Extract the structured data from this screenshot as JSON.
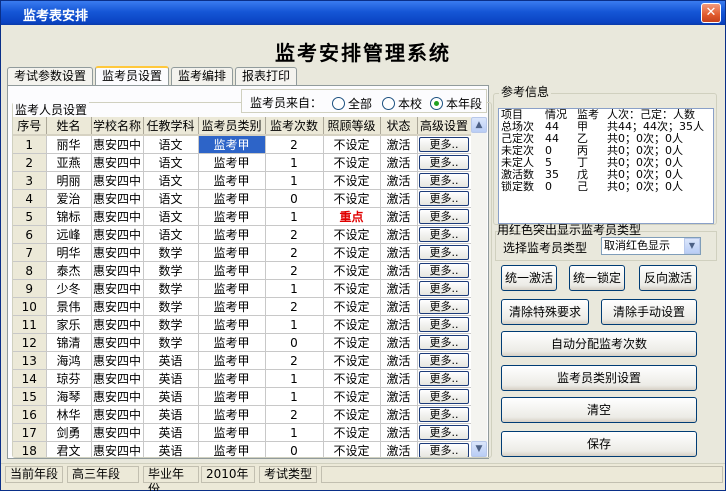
{
  "window": {
    "title": "监考表安排",
    "close": "✕"
  },
  "app_title": "监考安排管理系统",
  "tabs": [
    "考试参数设置",
    "监考员设置",
    "监考编排",
    "报表打印"
  ],
  "group_label": "监考人员设置",
  "source": {
    "label": "监考员来自：",
    "options": [
      "全部",
      "本校",
      "本年段"
    ],
    "selected": "本年段"
  },
  "table": {
    "columns": [
      "序号",
      "姓名",
      "学校名称",
      "任教学科",
      "监考员类别",
      "监考次数",
      "照顾等级",
      "状态",
      "高级设置"
    ],
    "rows": [
      [
        "1",
        "丽华",
        "惠安四中",
        "语文",
        "监考甲",
        "2",
        "不设定",
        "激活",
        "更多.."
      ],
      [
        "2",
        "亚燕",
        "惠安四中",
        "语文",
        "监考甲",
        "1",
        "不设定",
        "激活",
        "更多.."
      ],
      [
        "3",
        "明丽",
        "惠安四中",
        "语文",
        "监考甲",
        "1",
        "不设定",
        "激活",
        "更多.."
      ],
      [
        "4",
        "爱治",
        "惠安四中",
        "语文",
        "监考甲",
        "0",
        "不设定",
        "激活",
        "更多.."
      ],
      [
        "5",
        "锦标",
        "惠安四中",
        "语文",
        "监考甲",
        "1",
        "重点",
        "激活",
        "更多.."
      ],
      [
        "6",
        "远峰",
        "惠安四中",
        "语文",
        "监考甲",
        "2",
        "不设定",
        "激活",
        "更多.."
      ],
      [
        "7",
        "明华",
        "惠安四中",
        "数学",
        "监考甲",
        "2",
        "不设定",
        "激活",
        "更多.."
      ],
      [
        "8",
        "泰杰",
        "惠安四中",
        "数学",
        "监考甲",
        "2",
        "不设定",
        "激活",
        "更多.."
      ],
      [
        "9",
        "少冬",
        "惠安四中",
        "数学",
        "监考甲",
        "1",
        "不设定",
        "激活",
        "更多.."
      ],
      [
        "10",
        "景伟",
        "惠安四中",
        "数学",
        "监考甲",
        "2",
        "不设定",
        "激活",
        "更多.."
      ],
      [
        "11",
        "家乐",
        "惠安四中",
        "数学",
        "监考甲",
        "1",
        "不设定",
        "激活",
        "更多.."
      ],
      [
        "12",
        "锦清",
        "惠安四中",
        "数学",
        "监考甲",
        "0",
        "不设定",
        "激活",
        "更多.."
      ],
      [
        "13",
        "海鸿",
        "惠安四中",
        "英语",
        "监考甲",
        "2",
        "不设定",
        "激活",
        "更多.."
      ],
      [
        "14",
        "琼芬",
        "惠安四中",
        "英语",
        "监考甲",
        "1",
        "不设定",
        "激活",
        "更多.."
      ],
      [
        "15",
        "海琴",
        "惠安四中",
        "英语",
        "监考甲",
        "1",
        "不设定",
        "激活",
        "更多.."
      ],
      [
        "16",
        "林华",
        "惠安四中",
        "英语",
        "监考甲",
        "2",
        "不设定",
        "激活",
        "更多.."
      ],
      [
        "17",
        "剑勇",
        "惠安四中",
        "英语",
        "监考甲",
        "1",
        "不设定",
        "激活",
        "更多.."
      ],
      [
        "18",
        "君文",
        "惠安四中",
        "英语",
        "监考甲",
        "0",
        "不设定",
        "激活",
        "更多.."
      ]
    ],
    "selected_cell": {
      "row": 1,
      "col": 5
    },
    "highlight_color": "#e00000",
    "selection_color": "#2d64c8"
  },
  "scroll": {
    "up": "▲",
    "down": "▼"
  },
  "info": {
    "label": "参考信息",
    "header": [
      "项目",
      "情况",
      "监考",
      "人次：己定：人数"
    ],
    "rows": [
      [
        "总场次",
        "44",
        "甲",
        "共44；44次；35人"
      ],
      [
        "己定次",
        "44",
        "乙",
        "共0；0次；0人"
      ],
      [
        "未定次",
        "0",
        "丙",
        "共0；0次；0人"
      ],
      [
        "未定人",
        "5",
        "丁",
        "共0；0次；0人"
      ],
      [
        "激活数",
        "35",
        "戊",
        "共0；0次；0人"
      ],
      [
        "锁定数",
        "0",
        "己",
        "共0；0次；0人"
      ]
    ]
  },
  "highlight": {
    "label": "用红色突出显示监考员类型",
    "select_label": "选择监考员类型",
    "selected": "取消红色显示",
    "arrow": "▼"
  },
  "buttons": {
    "activate_all": "统一激活",
    "lock_all": "统一锁定",
    "reverse_activate": "反向激活",
    "clear_special": "清除特殊要求",
    "clear_manual": "清除手动设置",
    "auto_assign": "自动分配监考次数",
    "category_settings": "监考员类别设置",
    "clear": "清空",
    "save": "保存"
  },
  "status": {
    "grade_label": "当前年段",
    "grade_value": "高三年段",
    "year_label": "毕业年份",
    "year_value": "2010年",
    "exam_label": "考试类型",
    "exam_value": ""
  }
}
